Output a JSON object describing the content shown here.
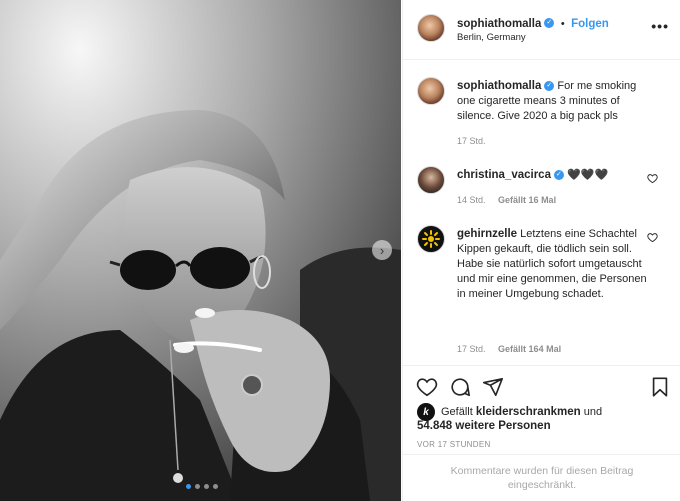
{
  "post": {
    "username": "sophiathomalla",
    "follow_label": "Folgen",
    "location": "Berlin, Germany",
    "more_icon": "more-options-icon",
    "verified_icon": "verified-badge-icon"
  },
  "caption": {
    "username": "sophiathomalla",
    "text": "For me smoking one cigarette means 3 minutes of silence. Give 2020 a big pack pls",
    "time": "17 Std."
  },
  "comments": [
    {
      "username": "christina_vacirca",
      "text": "🖤🖤🖤",
      "time": "14 Std.",
      "likes": "Gefällt 16 Mal",
      "verified": true
    },
    {
      "username": "gehirnzelle",
      "text": "Letztens eine Schachtel Kippen gekauft, die tödlich sein soll. Habe sie natürlich sofort umgetauscht und mir eine genommen, die Personen in meiner Umgebung schadet.",
      "time": "17 Std.",
      "likes": "Gefällt 164 Mal",
      "verified": false
    }
  ],
  "likes": {
    "prefix": "Gefällt",
    "user": "kleiderschrankmen",
    "connector": "und",
    "others": "54.848 weitere Personen"
  },
  "timestamp": "VOR 17 STUNDEN",
  "comments_disabled": "Kommentare wurden für diesen Beitrag eingeschränkt.",
  "colors": {
    "accent": "#3897f0",
    "text": "#262626",
    "muted": "#8e8e8e",
    "border": "#efefef"
  },
  "carousel": {
    "slide_count": 4,
    "active_index": 0,
    "next_icon": "chevron-right-icon"
  }
}
